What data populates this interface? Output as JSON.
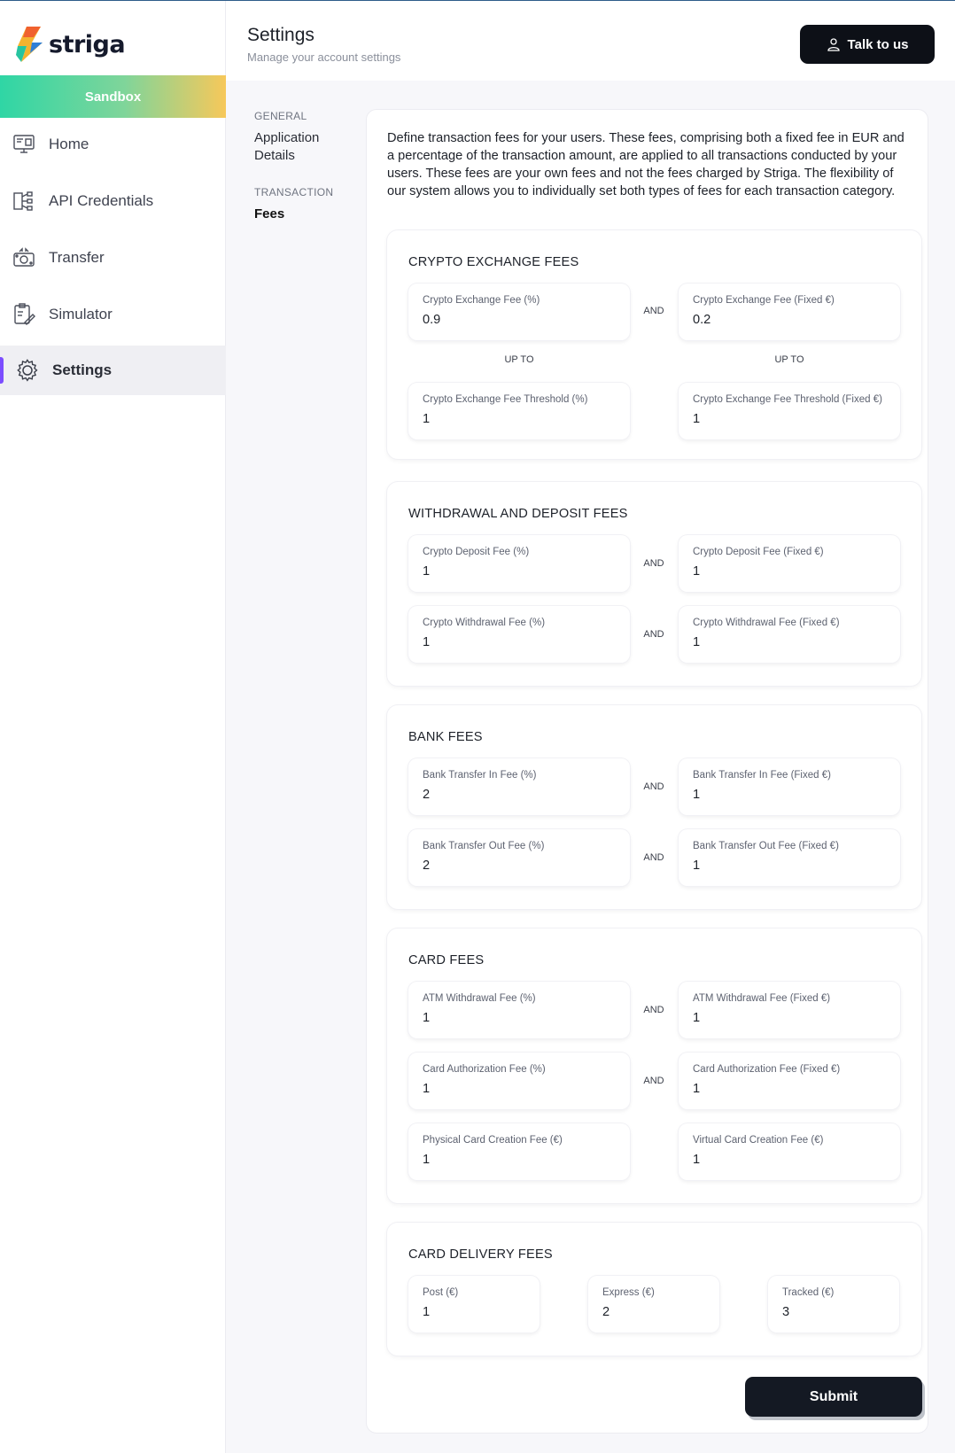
{
  "app": {
    "name": "striga",
    "environment": "Sandbox"
  },
  "sidebar": {
    "items": [
      {
        "label": "Home",
        "icon": "monitor-icon"
      },
      {
        "label": "API Credentials",
        "icon": "network-icon"
      },
      {
        "label": "Transfer",
        "icon": "transfer-icon"
      },
      {
        "label": "Simulator",
        "icon": "clipboard-icon"
      },
      {
        "label": "Settings",
        "icon": "gear-icon",
        "active": true
      }
    ]
  },
  "header": {
    "title": "Settings",
    "subtitle": "Manage your account settings",
    "talk_button": "Talk to us"
  },
  "subnav": {
    "general_heading": "GENERAL",
    "general_link": "Application Details",
    "transaction_heading": "TRANSACTION",
    "transaction_link": "Fees"
  },
  "intro": "Define transaction fees for your users. These fees, comprising both a fixed fee in EUR and a percentage of the transaction amount, are applied to all transactions conducted by your users. These fees are your own fees and not the fees charged by Striga. The flexibility of our system allows you to individually set both types of fees for each transaction category.",
  "conjunctions": {
    "and": "AND",
    "up_to": "UP TO"
  },
  "crypto_exchange": {
    "title": "CRYPTO EXCHANGE FEES",
    "fee_pct": {
      "label": "Crypto Exchange Fee (%)",
      "value": "0.9"
    },
    "fee_fixed": {
      "label": "Crypto Exchange Fee (Fixed €)",
      "value": "0.2"
    },
    "threshold_pct": {
      "label": "Crypto Exchange Fee Threshold (%)",
      "value": "1"
    },
    "threshold_fixed": {
      "label": "Crypto Exchange Fee Threshold (Fixed €)",
      "value": "1"
    }
  },
  "withdrawal_deposit": {
    "title": "WITHDRAWAL AND DEPOSIT FEES",
    "deposit_pct": {
      "label": "Crypto Deposit Fee (%)",
      "value": "1"
    },
    "deposit_fixed": {
      "label": "Crypto Deposit Fee (Fixed €)",
      "value": "1"
    },
    "withdrawal_pct": {
      "label": "Crypto Withdrawal Fee (%)",
      "value": "1"
    },
    "withdrawal_fixed": {
      "label": "Crypto Withdrawal Fee (Fixed €)",
      "value": "1"
    }
  },
  "bank": {
    "title": "BANK FEES",
    "in_pct": {
      "label": "Bank Transfer In Fee (%)",
      "value": "2"
    },
    "in_fixed": {
      "label": "Bank Transfer In Fee (Fixed €)",
      "value": "1"
    },
    "out_pct": {
      "label": "Bank Transfer Out Fee (%)",
      "value": "2"
    },
    "out_fixed": {
      "label": "Bank Transfer Out Fee (Fixed €)",
      "value": "1"
    }
  },
  "card": {
    "title": "CARD FEES",
    "atm_pct": {
      "label": "ATM Withdrawal Fee (%)",
      "value": "1"
    },
    "atm_fixed": {
      "label": "ATM Withdrawal Fee (Fixed €)",
      "value": "1"
    },
    "auth_pct": {
      "label": "Card Authorization Fee (%)",
      "value": "1"
    },
    "auth_fixed": {
      "label": "Card Authorization Fee (Fixed €)",
      "value": "1"
    },
    "physical": {
      "label": "Physical Card Creation Fee (€)",
      "value": "1"
    },
    "virtual": {
      "label": "Virtual Card Creation Fee (€)",
      "value": "1"
    }
  },
  "delivery": {
    "title": "CARD DELIVERY FEES",
    "post": {
      "label": "Post (€)",
      "value": "1"
    },
    "express": {
      "label": "Express (€)",
      "value": "2"
    },
    "tracked": {
      "label": "Tracked (€)",
      "value": "3"
    }
  },
  "submit_label": "Submit",
  "colors": {
    "accent": "#7c4dff",
    "button": "#0d1017",
    "sandbox_gradient_start": "#2fd6a5",
    "sandbox_gradient_end": "#f7c85a"
  }
}
